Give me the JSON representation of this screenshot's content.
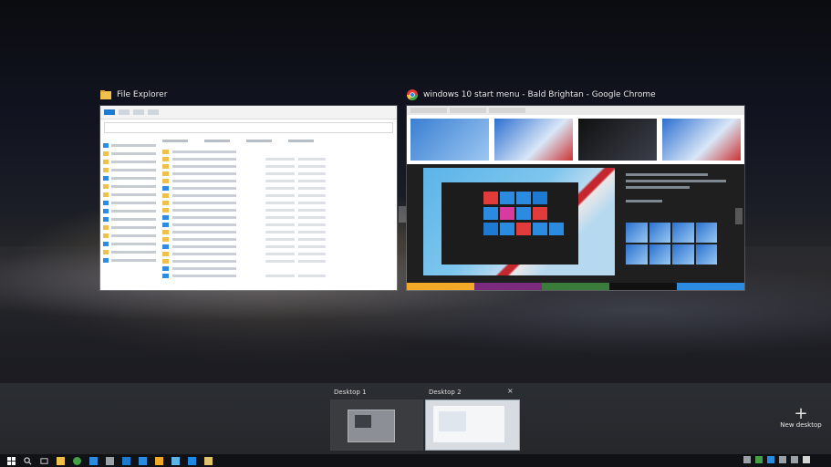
{
  "windows": [
    {
      "id": "file-explorer",
      "title": "File Explorer",
      "icon": "file-explorer-icon",
      "accent": "#f0c04a"
    },
    {
      "id": "chrome",
      "title": "windows 10 start menu - Bald Brightan - Google Chrome",
      "icon": "chrome-icon",
      "accent": "#e53935"
    }
  ],
  "virtual_desktops": [
    {
      "label": "Desktop 1",
      "active": false
    },
    {
      "label": "Desktop 2",
      "active": true,
      "close_glyph": "×"
    }
  ],
  "new_desktop": {
    "label": "New desktop",
    "glyph": "+"
  },
  "taskbar": {
    "icons": [
      "start-icon",
      "search-icon",
      "task-view-icon",
      "file-explorer-icon",
      "chrome-icon",
      "store-icon",
      "mail-icon",
      "settings-icon",
      "calendar-icon",
      "photos-icon",
      "weather-icon",
      "edge-icon",
      "folder-icon"
    ],
    "tray_icons": [
      "chevron-up-icon",
      "network-icon",
      "volume-icon",
      "battery-icon",
      "notification-icon",
      "keyboard-icon"
    ],
    "clock": ""
  },
  "colors": {
    "taskbar": "#101215",
    "desktop_bar": "#2b2e33",
    "accent_blue": "#1e7ad0"
  }
}
